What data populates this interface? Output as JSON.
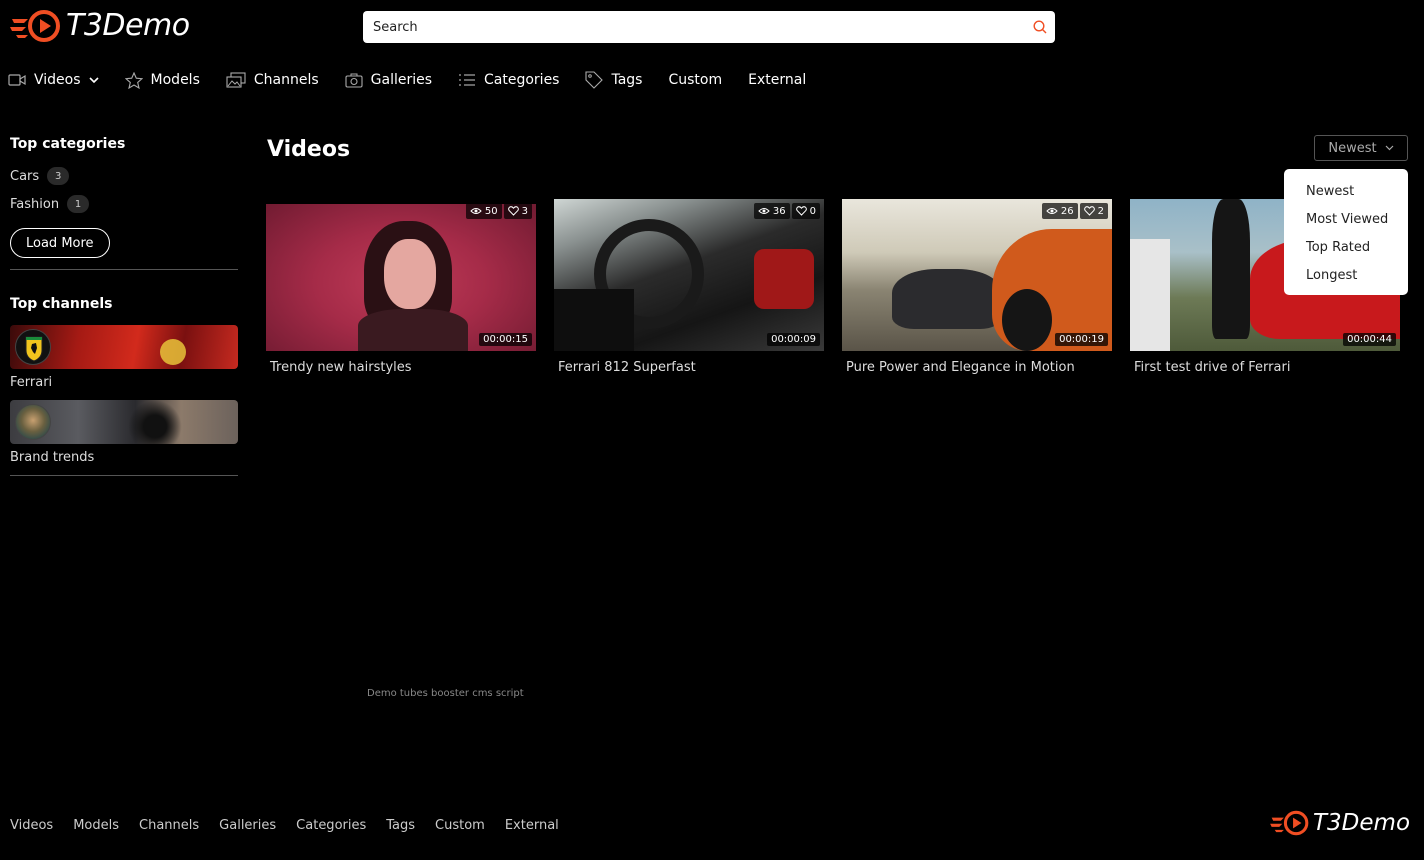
{
  "brand": {
    "name": "T3Demo",
    "accent": "#f04e23"
  },
  "search": {
    "placeholder": "Search"
  },
  "nav": [
    {
      "label": "Videos",
      "icon": "video-camera-icon",
      "dropdown": true
    },
    {
      "label": "Models",
      "icon": "star-icon"
    },
    {
      "label": "Channels",
      "icon": "images-icon"
    },
    {
      "label": "Galleries",
      "icon": "camera-icon"
    },
    {
      "label": "Categories",
      "icon": "list-icon"
    },
    {
      "label": "Tags",
      "icon": "tag-icon"
    },
    {
      "label": "Custom"
    },
    {
      "label": "External"
    }
  ],
  "sidebar": {
    "categories_title": "Top categories",
    "categories": [
      {
        "name": "Cars",
        "count": "3"
      },
      {
        "name": "Fashion",
        "count": "1"
      }
    ],
    "load_more": "Load More",
    "channels_title": "Top channels",
    "channels": [
      {
        "name": "Ferrari"
      },
      {
        "name": "Brand trends"
      }
    ]
  },
  "main": {
    "title": "Videos",
    "sort_selected": "Newest",
    "sort_options": [
      "Newest",
      "Most Viewed",
      "Top Rated",
      "Longest"
    ],
    "videos": [
      {
        "title": "Trendy new hairstyles",
        "views": "50",
        "likes": "3",
        "duration": "00:00:15"
      },
      {
        "title": "Ferrari 812 Superfast",
        "views": "36",
        "likes": "0",
        "duration": "00:00:09"
      },
      {
        "title": "Pure Power and Elegance in Motion",
        "views": "26",
        "likes": "2",
        "duration": "00:00:19"
      },
      {
        "title": "First test drive of Ferrari",
        "views": "",
        "likes": "",
        "duration": "00:00:44"
      }
    ]
  },
  "footer": {
    "note": "Demo tubes booster cms script",
    "links": [
      "Videos",
      "Models",
      "Channels",
      "Galleries",
      "Categories",
      "Tags",
      "Custom",
      "External"
    ]
  }
}
